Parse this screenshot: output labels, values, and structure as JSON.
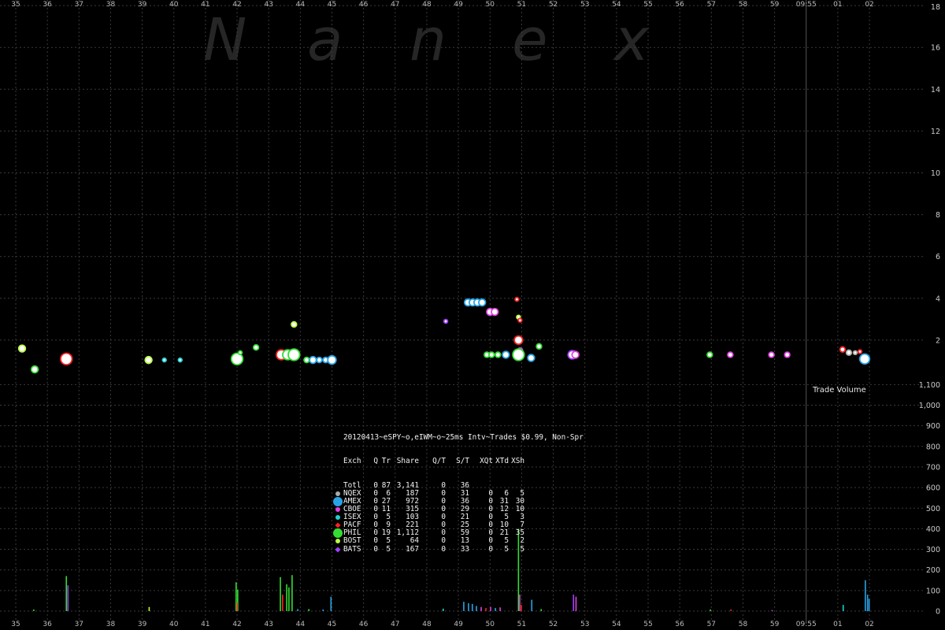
{
  "watermark": [
    "N",
    "a",
    "n",
    "e",
    "x"
  ],
  "x_ticks": [
    "35",
    "36",
    "37",
    "38",
    "39",
    "40",
    "41",
    "42",
    "43",
    "44",
    "45",
    "46",
    "47",
    "48",
    "49",
    "50",
    "51",
    "52",
    "53",
    "54",
    "55",
    "56",
    "57",
    "58",
    "59",
    "09:55",
    "01",
    "02"
  ],
  "colors": {
    "background": "#000000",
    "grid": "#3a3a3a",
    "NQEX": "#aaaaaa",
    "AMEX": "#29a3e6",
    "CBOE": "#e040e0",
    "ISEX": "#20d0d0",
    "PACF": "#ff2020",
    "PHIL": "#33dd33",
    "BOST": "#b8ff40",
    "BATS": "#a040ff"
  },
  "legend": {
    "title": "20120413~eSPY~o,eIWM~o~25ms Intv~Trades $0.99, Non-Spr",
    "headers": [
      "Exch",
      "Q",
      "Tr",
      "Share",
      "Q/T",
      "S/T",
      "XQt",
      "XTd",
      "XSh"
    ],
    "rows": [
      {
        "marker": "none",
        "color": "",
        "cells": [
          "Totl",
          "0",
          "87",
          "3,141",
          "0",
          "36",
          "",
          "",
          ""
        ]
      },
      {
        "marker": "dot",
        "color": "#aaaaaa",
        "cells": [
          "NQEX",
          "0",
          "6",
          "187",
          "0",
          "31",
          "0",
          "6",
          "5"
        ]
      },
      {
        "marker": "big",
        "color": "#29a3e6",
        "cells": [
          "AMEX",
          "0",
          "27",
          "972",
          "0",
          "36",
          "0",
          "31",
          "30"
        ]
      },
      {
        "marker": "dot",
        "color": "#e040e0",
        "cells": [
          "CBOE",
          "0",
          "11",
          "315",
          "0",
          "29",
          "0",
          "12",
          "10"
        ]
      },
      {
        "marker": "dot",
        "color": "#20d0d0",
        "cells": [
          "ISEX",
          "0",
          "5",
          "103",
          "0",
          "21",
          "0",
          "5",
          "3"
        ]
      },
      {
        "marker": "diam",
        "color": "#ff2020",
        "cells": [
          "PACF",
          "0",
          "9",
          "221",
          "0",
          "25",
          "0",
          "10",
          "7"
        ]
      },
      {
        "marker": "big",
        "color": "#33dd33",
        "cells": [
          "PHIL",
          "0",
          "19",
          "1,112",
          "0",
          "59",
          "0",
          "21",
          "35"
        ]
      },
      {
        "marker": "dot",
        "color": "#b8ff40",
        "cells": [
          "BOST",
          "0",
          "5",
          "64",
          "0",
          "13",
          "0",
          "5",
          "2"
        ]
      },
      {
        "marker": "diam",
        "color": "#a040ff",
        "cells": [
          "BATS",
          "0",
          "5",
          "167",
          "0",
          "33",
          "0",
          "5",
          "5"
        ]
      }
    ]
  },
  "chart_data": [
    {
      "type": "scatter",
      "title": "",
      "y_ticks": [
        "18",
        "16",
        "14",
        "12",
        "10",
        "8",
        "6",
        "4",
        "2"
      ],
      "ylim": [
        0,
        18
      ],
      "x_unit": "seconds past 09:54:35, ticks every second",
      "xlim": [
        34.6,
        63.1
      ],
      "points": [
        {
          "t": 35.2,
          "y": 1.6,
          "exch": "BOST",
          "size": 4
        },
        {
          "t": 35.6,
          "y": 0.6,
          "exch": "PHIL",
          "size": 4
        },
        {
          "t": 36.6,
          "y": 1.1,
          "exch": "PACF",
          "size": 7
        },
        {
          "t": 39.2,
          "y": 1.05,
          "exch": "BOST",
          "size": 4
        },
        {
          "t": 39.7,
          "y": 1.05,
          "exch": "ISEX",
          "size": 2
        },
        {
          "t": 40.2,
          "y": 1.05,
          "exch": "ISEX",
          "size": 2
        },
        {
          "t": 42.0,
          "y": 1.1,
          "exch": "PHIL",
          "size": 7
        },
        {
          "t": 42.1,
          "y": 1.4,
          "exch": "PHIL",
          "size": 2
        },
        {
          "t": 42.6,
          "y": 1.65,
          "exch": "PHIL",
          "size": 3
        },
        {
          "t": 43.4,
          "y": 1.3,
          "exch": "PACF",
          "size": 6
        },
        {
          "t": 43.6,
          "y": 1.3,
          "exch": "PHIL",
          "size": 6
        },
        {
          "t": 43.8,
          "y": 1.3,
          "exch": "PHIL",
          "size": 7
        },
        {
          "t": 43.8,
          "y": 2.75,
          "exch": "BOST",
          "size": 3
        },
        {
          "t": 44.2,
          "y": 1.05,
          "exch": "PHIL",
          "size": 3
        },
        {
          "t": 44.4,
          "y": 1.05,
          "exch": "AMEX",
          "size": 4
        },
        {
          "t": 44.6,
          "y": 1.05,
          "exch": "AMEX",
          "size": 3
        },
        {
          "t": 44.8,
          "y": 1.05,
          "exch": "AMEX",
          "size": 3
        },
        {
          "t": 45.0,
          "y": 1.05,
          "exch": "AMEX",
          "size": 5
        },
        {
          "t": 48.6,
          "y": 2.9,
          "exch": "BATS",
          "size": 2
        },
        {
          "t": 49.3,
          "y": 3.8,
          "exch": "AMEX",
          "size": 4
        },
        {
          "t": 49.45,
          "y": 3.8,
          "exch": "AMEX",
          "size": 4
        },
        {
          "t": 49.6,
          "y": 3.8,
          "exch": "AMEX",
          "size": 4
        },
        {
          "t": 49.75,
          "y": 3.8,
          "exch": "AMEX",
          "size": 4
        },
        {
          "t": 49.9,
          "y": 1.3,
          "exch": "PHIL",
          "size": 3
        },
        {
          "t": 50.05,
          "y": 1.3,
          "exch": "PHIL",
          "size": 3
        },
        {
          "t": 50.0,
          "y": 3.35,
          "exch": "CBOE",
          "size": 4
        },
        {
          "t": 50.15,
          "y": 3.35,
          "exch": "CBOE",
          "size": 4
        },
        {
          "t": 50.25,
          "y": 1.3,
          "exch": "PHIL",
          "size": 3
        },
        {
          "t": 50.5,
          "y": 1.3,
          "exch": "AMEX",
          "size": 4
        },
        {
          "t": 50.85,
          "y": 3.95,
          "exch": "PACF",
          "size": 2
        },
        {
          "t": 50.9,
          "y": 3.1,
          "exch": "BOST",
          "size": 2
        },
        {
          "t": 50.95,
          "y": 2.95,
          "exch": "PACF",
          "size": 2
        },
        {
          "t": 50.9,
          "y": 2.0,
          "exch": "PACF",
          "size": 5
        },
        {
          "t": 50.95,
          "y": 1.5,
          "exch": "CBOE",
          "size": 3
        },
        {
          "t": 50.9,
          "y": 1.3,
          "exch": "PHIL",
          "size": 7
        },
        {
          "t": 51.3,
          "y": 1.15,
          "exch": "AMEX",
          "size": 4
        },
        {
          "t": 51.55,
          "y": 1.7,
          "exch": "PHIL",
          "size": 3
        },
        {
          "t": 52.6,
          "y": 1.3,
          "exch": "BATS",
          "size": 5
        },
        {
          "t": 52.7,
          "y": 1.3,
          "exch": "CBOE",
          "size": 4
        },
        {
          "t": 56.95,
          "y": 1.3,
          "exch": "PHIL",
          "size": 3
        },
        {
          "t": 57.6,
          "y": 1.3,
          "exch": "CBOE",
          "size": 3
        },
        {
          "t": 58.9,
          "y": 1.3,
          "exch": "CBOE",
          "size": 3
        },
        {
          "t": 59.4,
          "y": 1.3,
          "exch": "CBOE",
          "size": 3
        },
        {
          "t": 61.15,
          "y": 1.55,
          "exch": "PACF",
          "size": 3
        },
        {
          "t": 61.35,
          "y": 1.4,
          "exch": "NQEX",
          "size": 3
        },
        {
          "t": 61.55,
          "y": 1.4,
          "exch": "NQEX",
          "size": 2
        },
        {
          "t": 61.7,
          "y": 1.45,
          "exch": "PACF",
          "size": 2
        },
        {
          "t": 61.85,
          "y": 1.1,
          "exch": "AMEX",
          "size": 6
        }
      ]
    },
    {
      "type": "bar",
      "title": "Trade Volume",
      "y_ticks": [
        "1,100",
        "1,000",
        "900",
        "800",
        "700",
        "600",
        "500",
        "400",
        "300",
        "200",
        "100",
        "0"
      ],
      "ylim": [
        0,
        1100
      ],
      "bars": [
        {
          "t": 36.58,
          "v": 170,
          "exch": "PHIL"
        },
        {
          "t": 36.63,
          "v": 125,
          "exch": "BATS"
        },
        {
          "t": 35.55,
          "v": 8,
          "exch": "PHIL"
        },
        {
          "t": 39.2,
          "v": 20,
          "exch": "BOST"
        },
        {
          "t": 41.95,
          "v": 140,
          "exch": "PHIL"
        },
        {
          "t": 42.0,
          "v": 105,
          "exch": "PHIL"
        },
        {
          "t": 41.98,
          "v": 40,
          "exch": "PACF"
        },
        {
          "t": 43.35,
          "v": 165,
          "exch": "PHIL"
        },
        {
          "t": 43.42,
          "v": 80,
          "exch": "PACF"
        },
        {
          "t": 43.55,
          "v": 130,
          "exch": "PHIL"
        },
        {
          "t": 43.62,
          "v": 115,
          "exch": "PHIL"
        },
        {
          "t": 43.72,
          "v": 175,
          "exch": "PHIL"
        },
        {
          "t": 43.9,
          "v": 10,
          "exch": "AMEX"
        },
        {
          "t": 44.25,
          "v": 10,
          "exch": "PHIL"
        },
        {
          "t": 44.7,
          "v": 8,
          "exch": "AMEX"
        },
        {
          "t": 44.95,
          "v": 70,
          "exch": "AMEX"
        },
        {
          "t": 48.5,
          "v": 12,
          "exch": "ISEX"
        },
        {
          "t": 49.15,
          "v": 45,
          "exch": "AMEX"
        },
        {
          "t": 49.3,
          "v": 38,
          "exch": "AMEX"
        },
        {
          "t": 49.42,
          "v": 35,
          "exch": "AMEX"
        },
        {
          "t": 49.55,
          "v": 25,
          "exch": "AMEX"
        },
        {
          "t": 49.7,
          "v": 20,
          "exch": "CBOE"
        },
        {
          "t": 49.85,
          "v": 15,
          "exch": "PACF"
        },
        {
          "t": 50.0,
          "v": 20,
          "exch": "CBOE"
        },
        {
          "t": 50.15,
          "v": 15,
          "exch": "AMEX"
        },
        {
          "t": 50.3,
          "v": 18,
          "exch": "CBOE"
        },
        {
          "t": 50.88,
          "v": 400,
          "exch": "PHIL"
        },
        {
          "t": 50.92,
          "v": 80,
          "exch": "CBOE"
        },
        {
          "t": 50.97,
          "v": 30,
          "exch": "PACF"
        },
        {
          "t": 51.3,
          "v": 55,
          "exch": "AMEX"
        },
        {
          "t": 51.6,
          "v": 10,
          "exch": "PHIL"
        },
        {
          "t": 52.62,
          "v": 80,
          "exch": "BATS"
        },
        {
          "t": 52.7,
          "v": 70,
          "exch": "CBOE"
        },
        {
          "t": 56.95,
          "v": 8,
          "exch": "PHIL"
        },
        {
          "t": 57.6,
          "v": 8,
          "exch": "PACF"
        },
        {
          "t": 58.9,
          "v": 5,
          "exch": "CBOE"
        },
        {
          "t": 61.15,
          "v": 30,
          "exch": "ISEX"
        },
        {
          "t": 61.85,
          "v": 150,
          "exch": "AMEX"
        },
        {
          "t": 61.92,
          "v": 80,
          "exch": "AMEX"
        },
        {
          "t": 61.97,
          "v": 60,
          "exch": "AMEX"
        }
      ]
    }
  ]
}
